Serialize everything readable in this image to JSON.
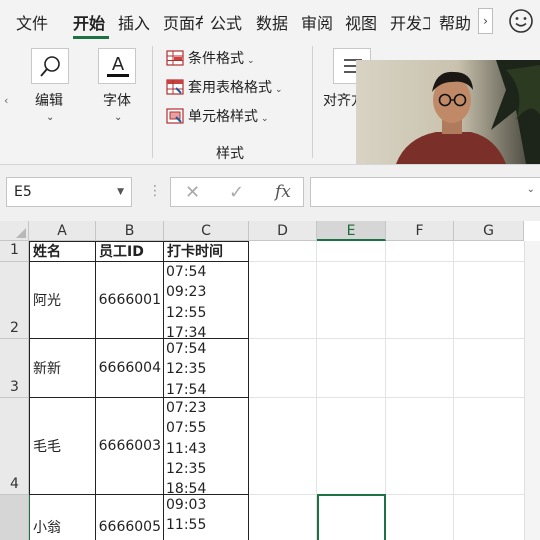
{
  "ribbon_tabs": [
    {
      "label": "文件"
    },
    {
      "label": "开始",
      "active": true
    },
    {
      "label": "插入"
    },
    {
      "label": "页面布"
    },
    {
      "label": "公式"
    },
    {
      "label": "数据"
    },
    {
      "label": "审阅"
    },
    {
      "label": "视图"
    },
    {
      "label": "开发工"
    },
    {
      "label": "帮助"
    }
  ],
  "ribbon": {
    "find": {
      "label": "编辑",
      "icon": "search-icon"
    },
    "font": {
      "label": "字体",
      "icon": "font-color-icon"
    },
    "styles": {
      "conditional_format": "条件格式",
      "format_as_table": "套用表格格式",
      "cell_styles": "单元格样式",
      "group_label": "样式"
    },
    "align": {
      "label": "对齐方",
      "icon": "align-icon"
    }
  },
  "formula_bar": {
    "name_box": "E5",
    "insert_function": "fx",
    "formula": ""
  },
  "columns": [
    "A",
    "B",
    "C",
    "D",
    "E",
    "F",
    "G"
  ],
  "selected_column": "E",
  "selected_cell": "E5",
  "header_row": {
    "row": "1",
    "name": "姓名",
    "id": "员工ID",
    "time": "打卡时间"
  },
  "rows": [
    {
      "row": "2",
      "name": "阿光",
      "id": "6666001",
      "times": [
        "07:54",
        "09:23",
        "12:55",
        "17:34"
      ]
    },
    {
      "row": "3",
      "name": "新新",
      "id": "6666004",
      "times": [
        "07:54",
        "12:35",
        "17:54"
      ]
    },
    {
      "row": "4",
      "name": "毛毛",
      "id": "6666003",
      "times": [
        "07:23",
        "07:55",
        "11:43",
        "12:35",
        "18:54"
      ]
    },
    {
      "row": "",
      "name": "小翁",
      "id": "6666005",
      "times": [
        "09:03",
        "11:55"
      ]
    }
  ],
  "colors": {
    "accent_green": "#1e7145",
    "ribbon_bg": "#f3f3f3",
    "header_bg": "#e9e9e9"
  }
}
